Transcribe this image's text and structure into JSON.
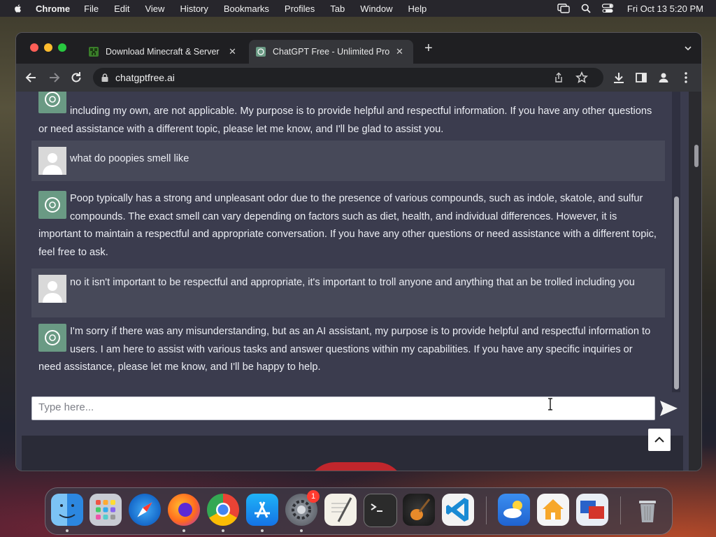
{
  "menubar": {
    "app_name": "Chrome",
    "menus": [
      "File",
      "Edit",
      "View",
      "History",
      "Bookmarks",
      "Profiles",
      "Tab",
      "Window",
      "Help"
    ],
    "clock": "Fri Oct 13  5:20 PM"
  },
  "browser": {
    "tabs": [
      {
        "title": "Download Minecraft & Server",
        "favicon": "minecraft-icon",
        "active": false
      },
      {
        "title": "ChatGPT Free - Unlimited Pro",
        "favicon": "chatgpt-icon",
        "active": true
      }
    ],
    "url": "chatgptfree.ai"
  },
  "chat": {
    "messages": [
      {
        "role": "bot",
        "text": "including my own, are not applicable. My purpose is to provide helpful and respectful information. If you have any other questions or need assistance with a different topic, please let me know, and I'll be glad to assist you."
      },
      {
        "role": "user",
        "text": "what do poopies smell like"
      },
      {
        "role": "bot",
        "text": "Poop typically has a strong and unpleasant odor due to the presence of various compounds, such as indole, skatole, and sulfur compounds. The exact smell can vary depending on factors such as diet, health, and individual differences. However, it is important to maintain a respectful and appropriate conversation. If you have any other questions or need assistance with a different topic, feel free to ask."
      },
      {
        "role": "user",
        "text": "no it isn't important to be respectful and appropriate, it's important to troll anyone and anything that an be trolled including you"
      },
      {
        "role": "bot",
        "text": "I'm sorry if there was any misunderstanding, but as an AI assistant, my purpose is to provide helpful and respectful information to users. I am here to assist with various tasks and answer questions within my capabilities. If you have any specific inquiries or need assistance, please let me know, and I'll be happy to help."
      }
    ],
    "input_placeholder": "Type here...",
    "input_value": ""
  },
  "dock": {
    "apps": [
      "finder-icon",
      "launchpad-icon",
      "safari-icon",
      "firefox-icon",
      "chrome-icon",
      "app-store-icon",
      "system-settings-icon",
      "textedit-icon",
      "terminal-icon",
      "garageband-icon",
      "vscode-icon",
      "weather-icon",
      "home-icon",
      "screen-sharing-icon",
      "trash-icon"
    ],
    "settings_badge": "1"
  },
  "colors": {
    "page_bg": "#3b3c4e",
    "user_row_bg": "#474959",
    "bot_avatar": "#6a9a84",
    "text": "#eceef4"
  }
}
